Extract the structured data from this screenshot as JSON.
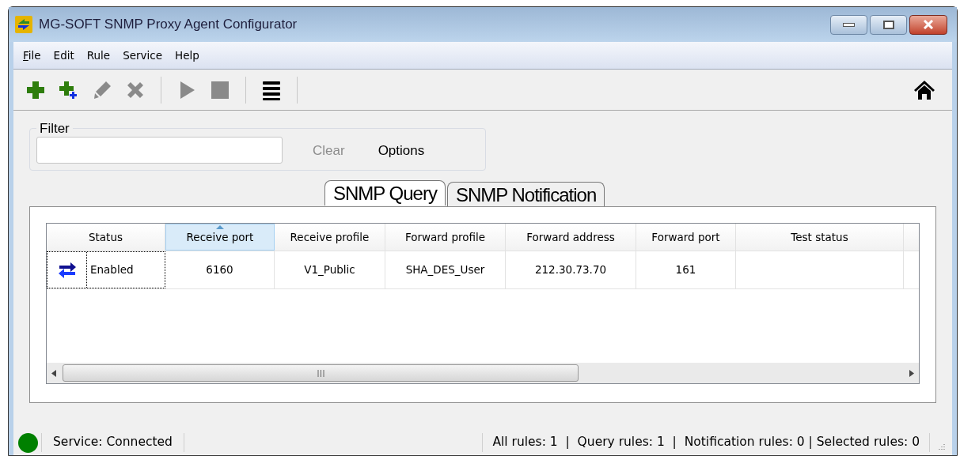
{
  "window": {
    "title": "MG-SOFT SNMP Proxy Agent Configurator"
  },
  "menu": [
    {
      "label": "File",
      "mnemonic": true
    },
    {
      "label": "Edit",
      "mnemonic": false
    },
    {
      "label": "Rule",
      "mnemonic": false
    },
    {
      "label": "Service",
      "mnemonic": false
    },
    {
      "label": "Help",
      "mnemonic": false
    }
  ],
  "toolbar": [
    {
      "kind": "add",
      "disabled": false
    },
    {
      "kind": "add-child",
      "disabled": false
    },
    {
      "kind": "edit",
      "disabled": true
    },
    {
      "kind": "delete",
      "disabled": true
    },
    {
      "kind": "separator"
    },
    {
      "kind": "start",
      "disabled": true
    },
    {
      "kind": "stop",
      "disabled": true
    },
    {
      "kind": "separator"
    },
    {
      "kind": "list",
      "disabled": false
    },
    {
      "kind": "separator"
    }
  ],
  "filter": {
    "label": "Filter",
    "buttons": [
      {
        "label": "Clear",
        "disabled": true
      },
      {
        "label": "Options",
        "disabled": false
      }
    ]
  },
  "tabs": [
    {
      "label": "SNMP Query",
      "selected": true
    },
    {
      "label": "SNMP Notification",
      "selected": false
    }
  ],
  "table": {
    "columns": [
      {
        "label": "Status",
        "sorted": false
      },
      {
        "label": "Receive port",
        "sorted": true
      },
      {
        "label": "Receive profile",
        "sorted": false
      },
      {
        "label": "Forward profile",
        "sorted": false
      },
      {
        "label": "Forward address",
        "sorted": false
      },
      {
        "label": "Forward port",
        "sorted": false
      },
      {
        "label": "Test status",
        "sorted": false
      }
    ],
    "rows": [
      {
        "focused": true,
        "cells": [
          "Enabled",
          "6160",
          "V1_Public",
          "SHA_DES_User",
          "212.30.73.70",
          "161",
          ""
        ]
      }
    ]
  },
  "status_bar": {
    "connected": true,
    "service": "Service: Connected",
    "rules": "All rules: 1  |  Query rules: 1  |  Notification rules: 0 | Selected rules: 0"
  }
}
